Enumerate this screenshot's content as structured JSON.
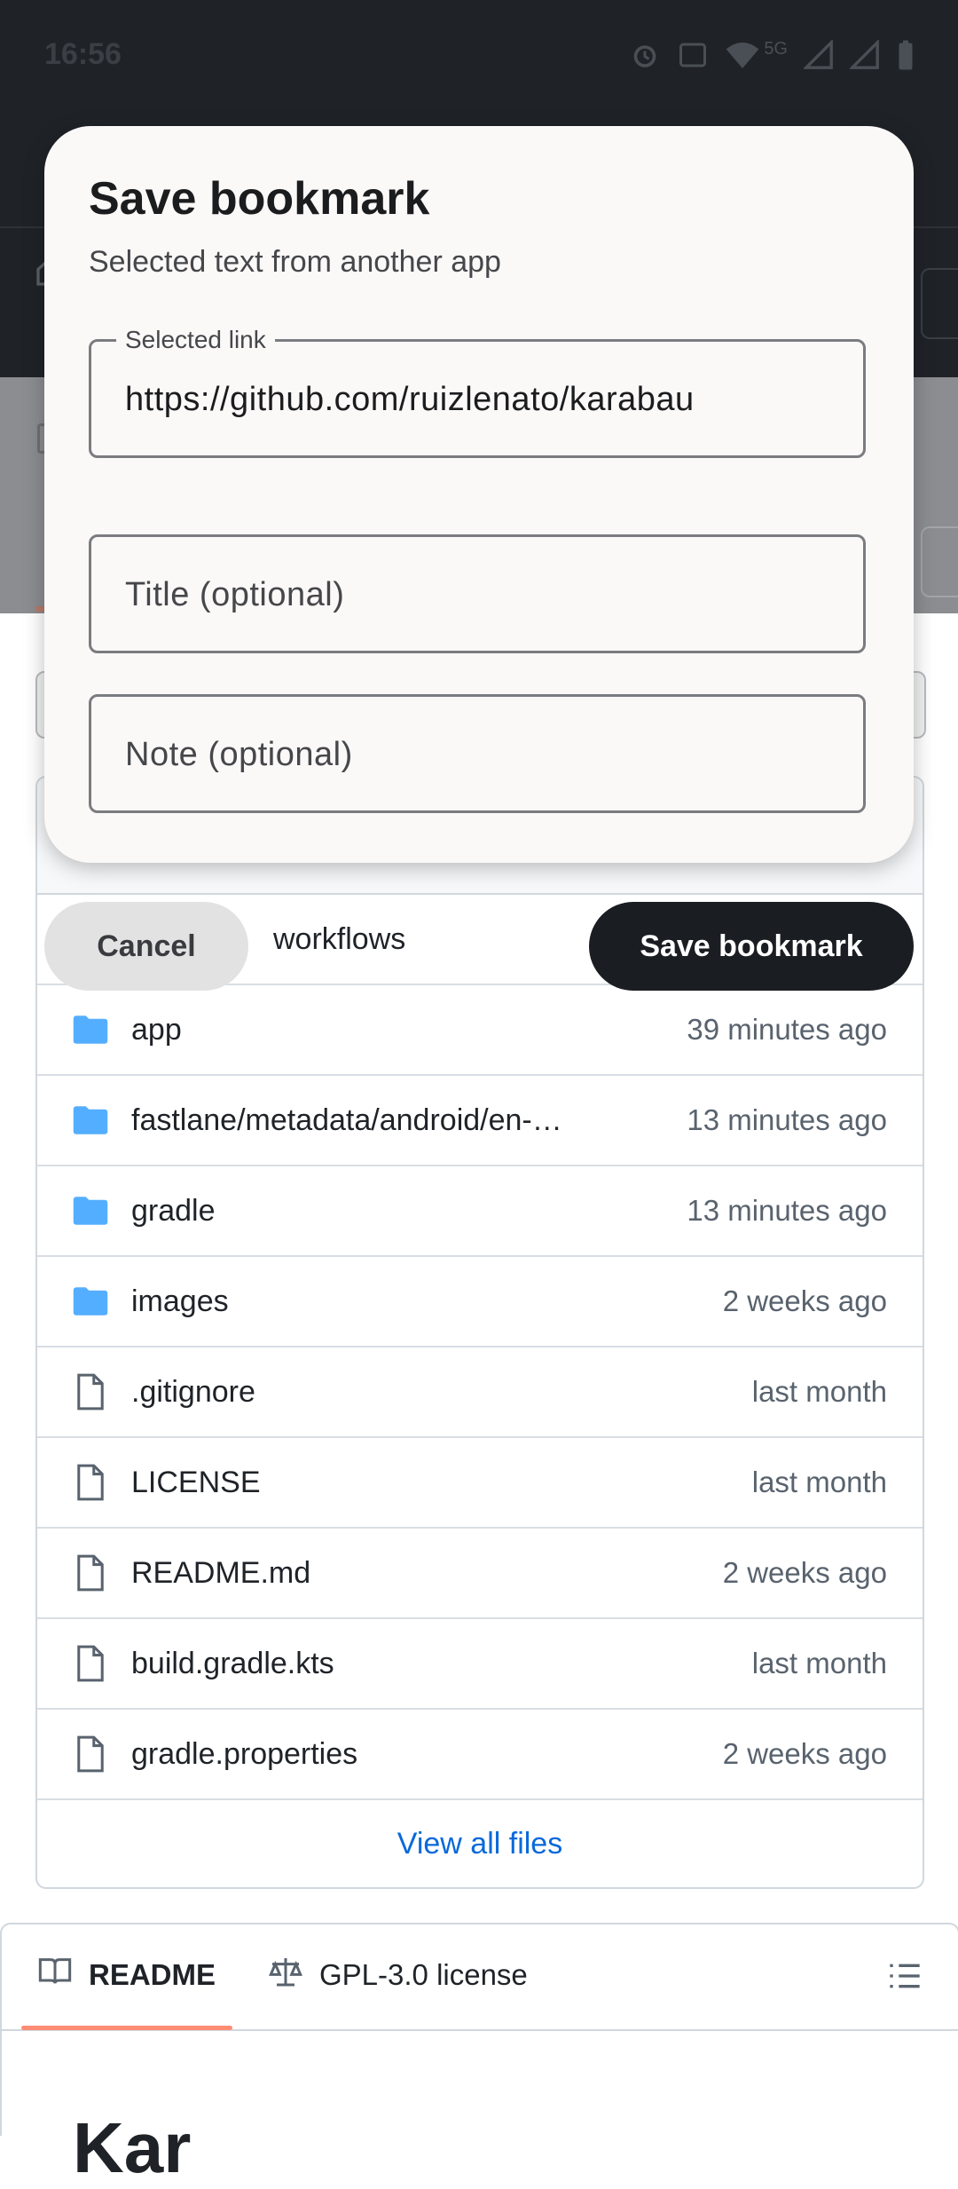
{
  "status_bar": {
    "time": "16:56",
    "icons": [
      "alarm-icon",
      "volte-icon",
      "wifi-icon",
      "signal-icon",
      "battery-icon"
    ],
    "network": "5G"
  },
  "dialog": {
    "title": "Save bookmark",
    "subtitle": "Selected text from another app",
    "link_label": "Selected link",
    "link_value": "https://github.com/ruizlenato/karabau",
    "title_placeholder": "Title (optional)",
    "note_placeholder": "Note (optional)",
    "cancel_label": "Cancel",
    "save_label": "Save bookmark"
  },
  "files": {
    "partial_row": "workflows",
    "rows": [
      {
        "name": "app",
        "time": "39 minutes ago",
        "type": "folder"
      },
      {
        "name": "fastlane/metadata/android/en-…",
        "time": "13 minutes ago",
        "type": "folder"
      },
      {
        "name": "gradle",
        "time": "13 minutes ago",
        "type": "folder"
      },
      {
        "name": "images",
        "time": "2 weeks ago",
        "type": "folder"
      },
      {
        "name": ".gitignore",
        "time": "last month",
        "type": "file"
      },
      {
        "name": "LICENSE",
        "time": "last month",
        "type": "file"
      },
      {
        "name": "README.md",
        "time": "2 weeks ago",
        "type": "file"
      },
      {
        "name": "build.gradle.kts",
        "time": "last month",
        "type": "file"
      },
      {
        "name": "gradle.properties",
        "time": "2 weeks ago",
        "type": "file"
      }
    ],
    "view_all": "View all files"
  },
  "readme": {
    "tab_readme": "README",
    "tab_license": "GPL-3.0 license",
    "heading": "Kar"
  },
  "colors": {
    "folder": "#54aeff",
    "link": "#0969da",
    "accent_underline": "#fd8c73",
    "dialog_bg": "#fbf8f8",
    "primary_button": "#1a1d21"
  }
}
